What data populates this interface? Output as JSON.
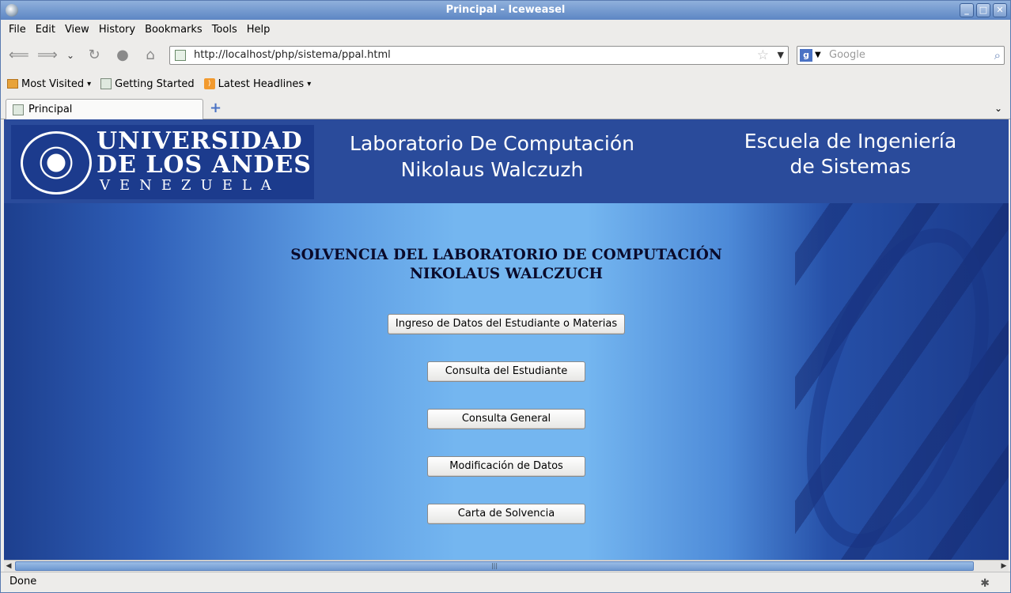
{
  "window": {
    "title": "Principal - Iceweasel",
    "buttons": [
      "_",
      "□",
      "✕"
    ]
  },
  "menu": [
    "File",
    "Edit",
    "View",
    "History",
    "Bookmarks",
    "Tools",
    "Help"
  ],
  "nav": {
    "url": "http://localhost/php/sistema/ppal.html",
    "search_placeholder": "Google",
    "search_engine_glyph": "g"
  },
  "bookmarks": [
    {
      "label": "Most Visited",
      "icon": "folder-icon",
      "dropdown": true
    },
    {
      "label": "Getting Started",
      "icon": "page-icon",
      "dropdown": false
    },
    {
      "label": "Latest Headlines",
      "icon": "rss-icon",
      "dropdown": true
    }
  ],
  "tabs": [
    {
      "label": "Principal",
      "active": true
    }
  ],
  "page": {
    "logo": {
      "line1": "UNIVERSIDAD",
      "line2": "DE LOS ANDES",
      "line3": "VENEZUELA"
    },
    "header_center": [
      "Laboratorio De Computación",
      "Nikolaus Walczuzh"
    ],
    "header_right": [
      "Escuela de Ingeniería",
      "de Sistemas"
    ],
    "title": [
      "SOLVENCIA DEL LABORATORIO DE COMPUTACIÓN",
      "NIKOLAUS WALCZUCH"
    ],
    "buttons": [
      "Ingreso de Datos del Estudiante o Materias",
      "Consulta del Estudiante",
      "Consulta General",
      "Modificación de Datos",
      "Carta de Solvencia"
    ]
  },
  "status": "Done",
  "colors": {
    "titlebar": "#5d86c4",
    "header": "#2a4b9b",
    "logo_bg": "#1c3b8d"
  }
}
